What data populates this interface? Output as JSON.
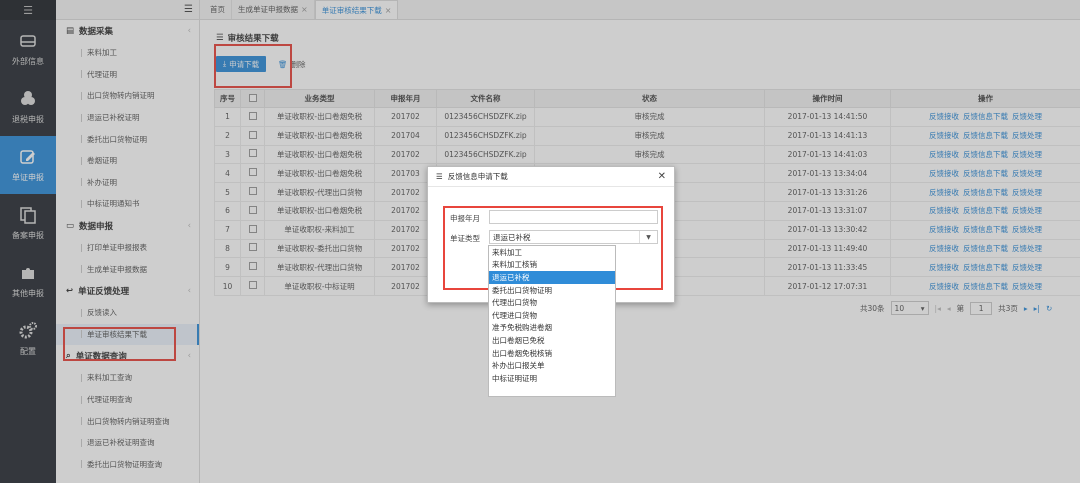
{
  "rail": {
    "items": [
      {
        "label": "外部信息",
        "icon": "drive-icon"
      },
      {
        "label": "退税申报",
        "icon": "boxes-icon"
      },
      {
        "label": "单证申报",
        "icon": "edit-icon"
      },
      {
        "label": "备案申报",
        "icon": "copy-icon"
      },
      {
        "label": "其他申报",
        "icon": "puzzle-icon"
      },
      {
        "label": "配置",
        "icon": "gears-icon"
      }
    ]
  },
  "menu": {
    "groups": [
      {
        "label": "数据采集",
        "items": [
          "来料加工",
          "代理证明",
          "出口货物转内销证明",
          "退运已补税证明",
          "委托出口货物证明",
          "卷烟证明",
          "补办证明",
          "中标证明通知书"
        ]
      },
      {
        "label": "数据申报",
        "items": [
          "打印单证申报报表",
          "生成单证申报数据"
        ]
      },
      {
        "label": "单证反馈处理",
        "items": [
          "反馈读入",
          "单证审核结果下载"
        ]
      },
      {
        "label": "单证数据查询",
        "items": [
          "来料加工查询",
          "代理证明查询",
          "出口货物转内销证明查询",
          "退运已补税证明查询",
          "委托出口货物证明查询"
        ]
      }
    ]
  },
  "tabs": [
    {
      "label": "首页",
      "closable": false
    },
    {
      "label": "生成单证申报数据",
      "closable": true
    },
    {
      "label": "单证审核结果下载",
      "closable": true
    }
  ],
  "panel": {
    "title": "审核结果下载",
    "apply_button": "申请下载",
    "delete_button": "删除"
  },
  "table": {
    "headers": [
      "序号",
      "",
      "业务类型",
      "申报年月",
      "文件名称",
      "状态",
      "操作时间",
      "操作"
    ],
    "action_links": [
      "反馈接收",
      "反馈信息下载",
      "反馈处理"
    ],
    "rows": [
      {
        "no": "1",
        "type": "单证收职权-出口卷烟免税",
        "ym": "201702",
        "file": "0123456CHSDZFK.zip",
        "status": "审核完成",
        "time": "2017-01-13 14:41:50"
      },
      {
        "no": "2",
        "type": "单证收职权-出口卷烟免税",
        "ym": "201704",
        "file": "0123456CHSDZFK.zip",
        "status": "审核完成",
        "time": "2017-01-13 14:41:13"
      },
      {
        "no": "3",
        "type": "单证收职权-出口卷烟免税",
        "ym": "201702",
        "file": "0123456CHSDZFK.zip",
        "status": "审核完成",
        "time": "2017-01-13 14:41:03"
      },
      {
        "no": "4",
        "type": "单证收职权-出口卷烟免税",
        "ym": "201703",
        "file": "",
        "status": "",
        "time": "2017-01-13 13:34:04"
      },
      {
        "no": "5",
        "type": "单证收职权-代理出口货物",
        "ym": "201702",
        "file": "",
        "status": "",
        "time": "2017-01-13 13:31:26"
      },
      {
        "no": "6",
        "type": "单证收职权-出口卷烟免税",
        "ym": "201702",
        "file": "",
        "status": "",
        "time": "2017-01-13 13:31:07"
      },
      {
        "no": "7",
        "type": "单证收职权-来料加工",
        "ym": "201702",
        "file": "",
        "status": "",
        "time": "2017-01-13 13:30:42"
      },
      {
        "no": "8",
        "type": "单证收职权-委托出口货物",
        "ym": "201702",
        "file": "",
        "status": "",
        "time": "2017-01-13 11:49:40"
      },
      {
        "no": "9",
        "type": "单证收职权-代理出口货物",
        "ym": "201702",
        "file": "",
        "status": "",
        "time": "2017-01-13 11:33:45"
      },
      {
        "no": "10",
        "type": "单证收职权-中标证明",
        "ym": "201702",
        "file": "",
        "status": "",
        "time": "2017-01-12 17:07:31"
      }
    ]
  },
  "pager": {
    "total": "共30条",
    "page_size": "10",
    "page_prefix": "第",
    "page": "1",
    "page_suffix": "共3页"
  },
  "modal": {
    "title": "反馈信息申请下载",
    "year_label": "申报年月",
    "type_label": "单证类型",
    "type_value": "退运已补税",
    "options": [
      "来料加工",
      "来料加工核销",
      "退运已补税",
      "委托出口货物证明",
      "代理出口货物",
      "代理进口货物",
      "准予免税购进卷烟",
      "出口卷烟已免税",
      "出口卷烟免税核销",
      "补办出口报关单",
      "中标证明证明"
    ],
    "selected_index": 2
  },
  "colors": {
    "accent": "#2f8cd8",
    "highlight": "#e8453c"
  }
}
